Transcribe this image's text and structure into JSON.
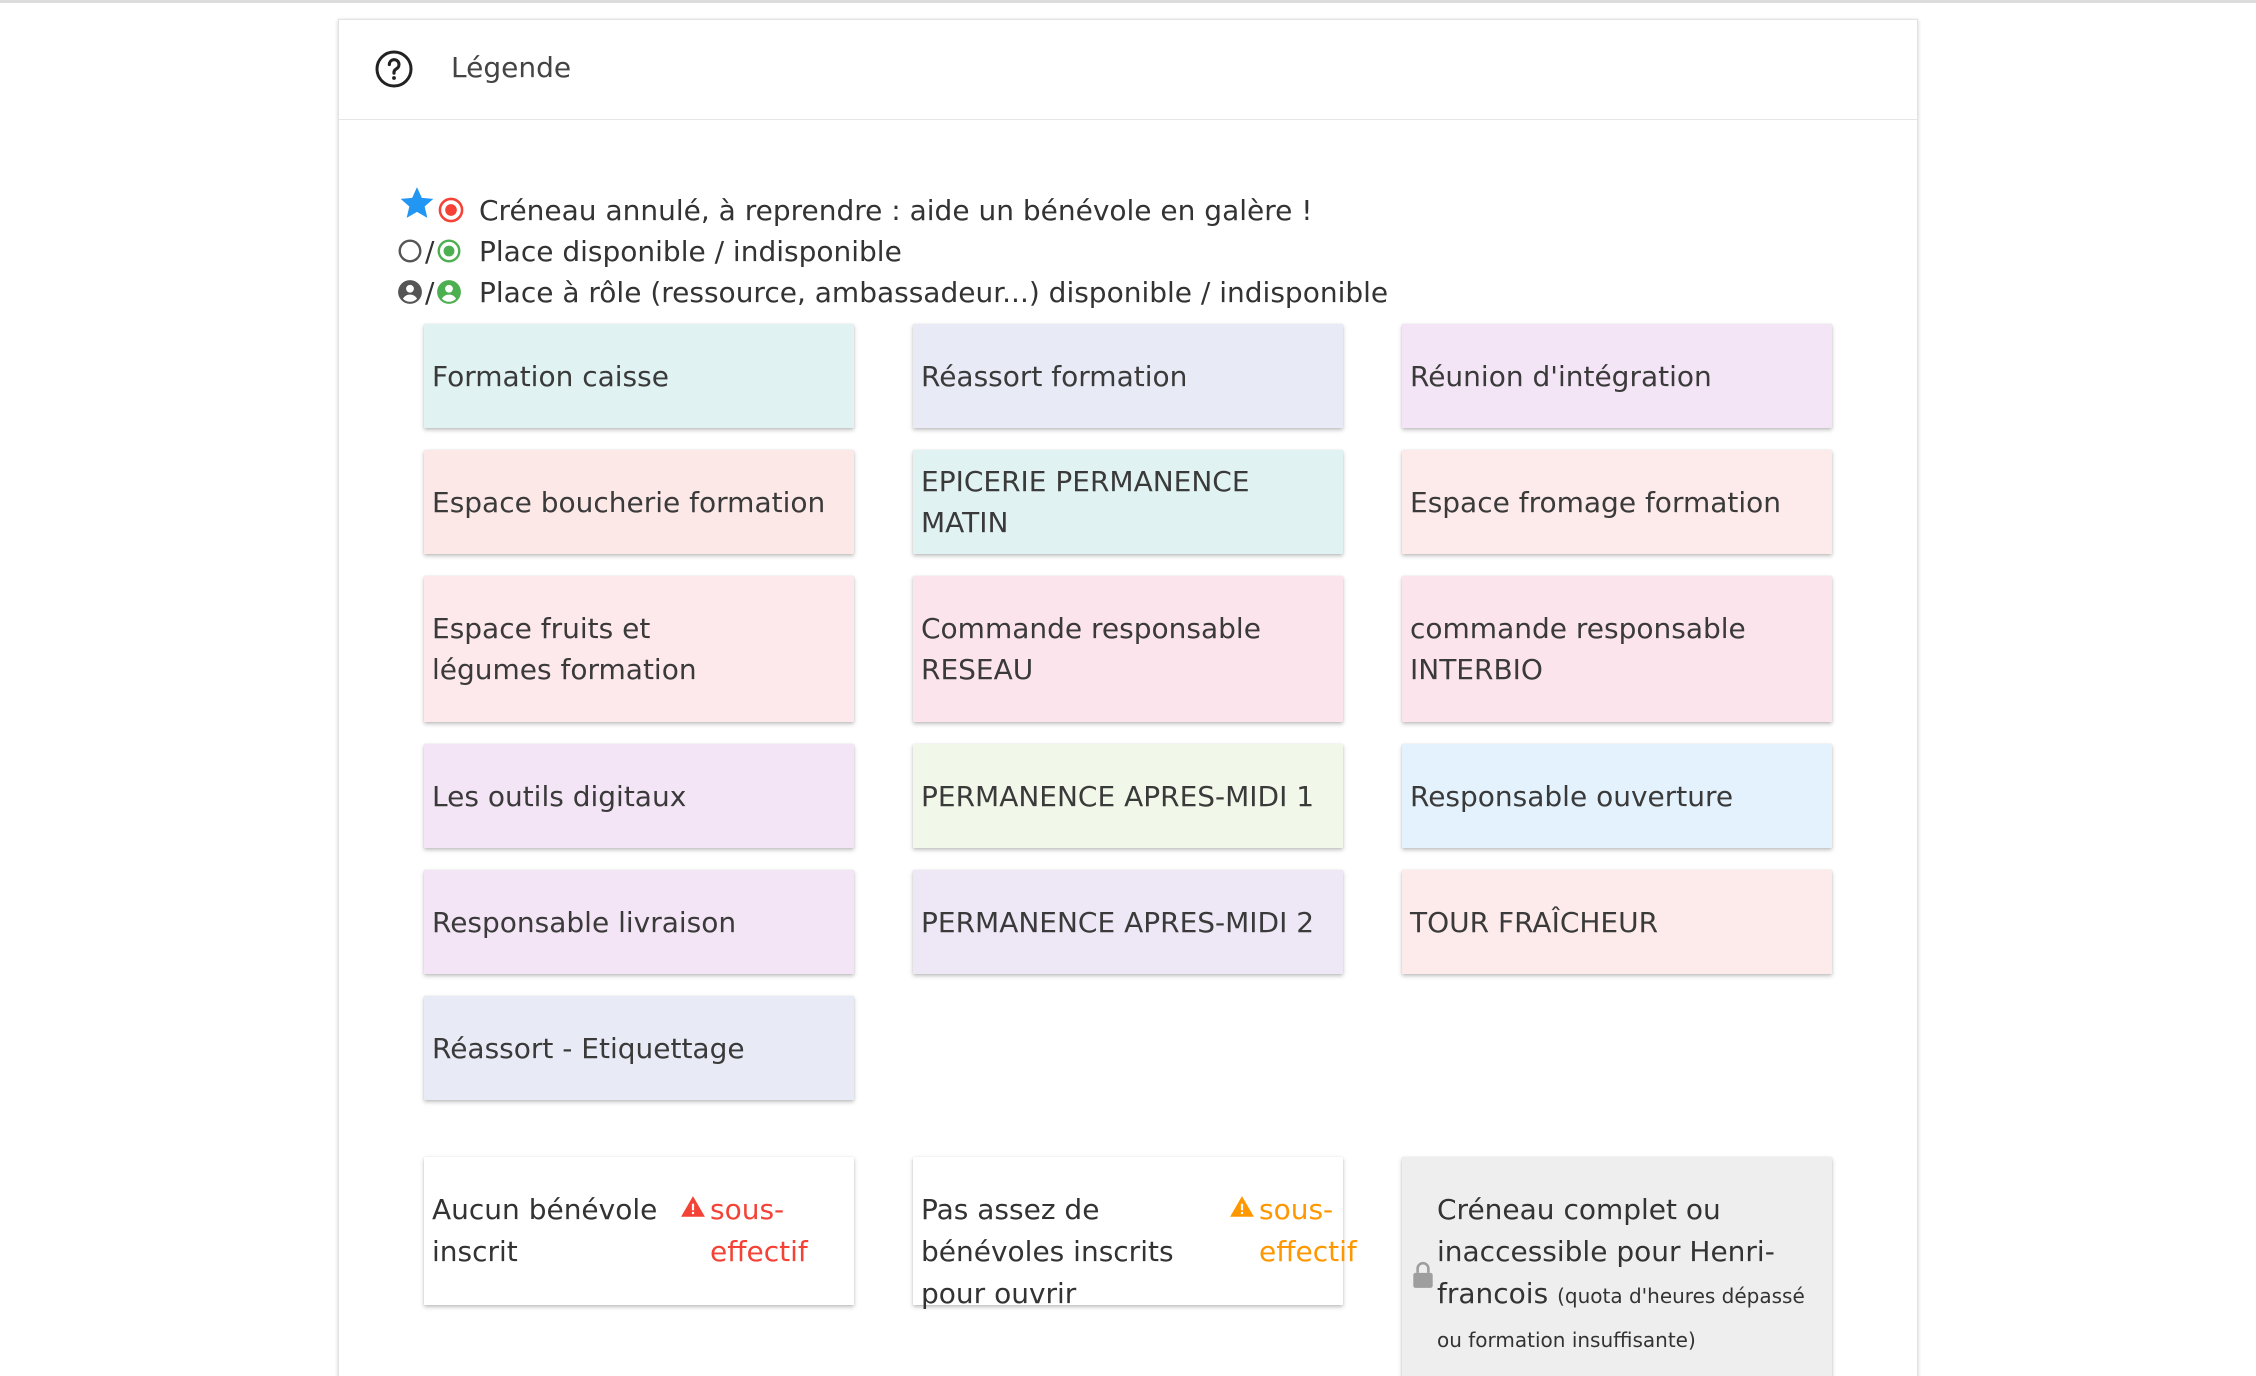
{
  "panel": {
    "title": "Légende"
  },
  "legend": {
    "cancelled": "Créneau annulé, à reprendre : aide un bénévole en galère !",
    "place": "Place disponible / indisponible",
    "role_place": "Place à rôle (ressource, ambassadeur...) disponible / indisponible",
    "slash": "/"
  },
  "cards": [
    {
      "label": "Formation caisse",
      "color": "#e0f2f1"
    },
    {
      "label": "Réassort formation",
      "color": "#e8eaf6"
    },
    {
      "label": "Réunion d'intégration",
      "color": "#f3e5f5"
    },
    {
      "label": "Espace boucherie formation",
      "color": "#fde8e8"
    },
    {
      "label": "EPICERIE PERMANENCE MATIN",
      "color": "#e0f2f1"
    },
    {
      "label": "Espace fromage formation",
      "color": "#fdeaea"
    },
    {
      "label": "Espace fruits et légumes formation",
      "color": "#fde8eb"
    },
    {
      "label": "Commande responsable RESEAU",
      "color": "#fbe4eb"
    },
    {
      "label": "commande responsable INTERBIO",
      "color": "#fbe4eb"
    },
    {
      "label": "Les outils digitaux",
      "color": "#f3e5f5"
    },
    {
      "label": "PERMANENCE APRES-MIDI 1",
      "color": "#f1f8e9"
    },
    {
      "label": "Responsable ouverture",
      "color": "#e3f2fd"
    },
    {
      "label": "Responsable livraison",
      "color": "#f3e5f5"
    },
    {
      "label": "PERMANENCE APRES-MIDI 2",
      "color": "#ede7f6"
    },
    {
      "label": "TOUR FRAÎCHEUR",
      "color": "#fdeaea"
    },
    {
      "label": "Réassort - Etiquettage",
      "color": "#e8eaf6"
    }
  ],
  "status": {
    "no_volunteer": {
      "label": "Aucun bénévole inscrit",
      "warning": "sous-effectif",
      "color": "#f44336"
    },
    "not_enough": {
      "label": "Pas assez de bénévoles inscrits pour ouvrir",
      "warning": "sous-effectif",
      "color": "#ff9800"
    },
    "locked": {
      "label": "Créneau complet ou inaccessible pour Henri-francois",
      "note": "(quota d'heures dépassé ou formation insuffisante)"
    }
  },
  "colors": {
    "star_blue": "#2196f3",
    "red": "#f44336",
    "green": "#4caf50",
    "grey_icon": "#555555"
  },
  "icons": [
    "help-circle-icon",
    "star-icon",
    "radio-checked-red-icon",
    "circle-outline-icon",
    "radio-checked-green-icon",
    "account-circle-grey-icon",
    "account-circle-green-icon",
    "alert-icon",
    "lock-icon"
  ]
}
